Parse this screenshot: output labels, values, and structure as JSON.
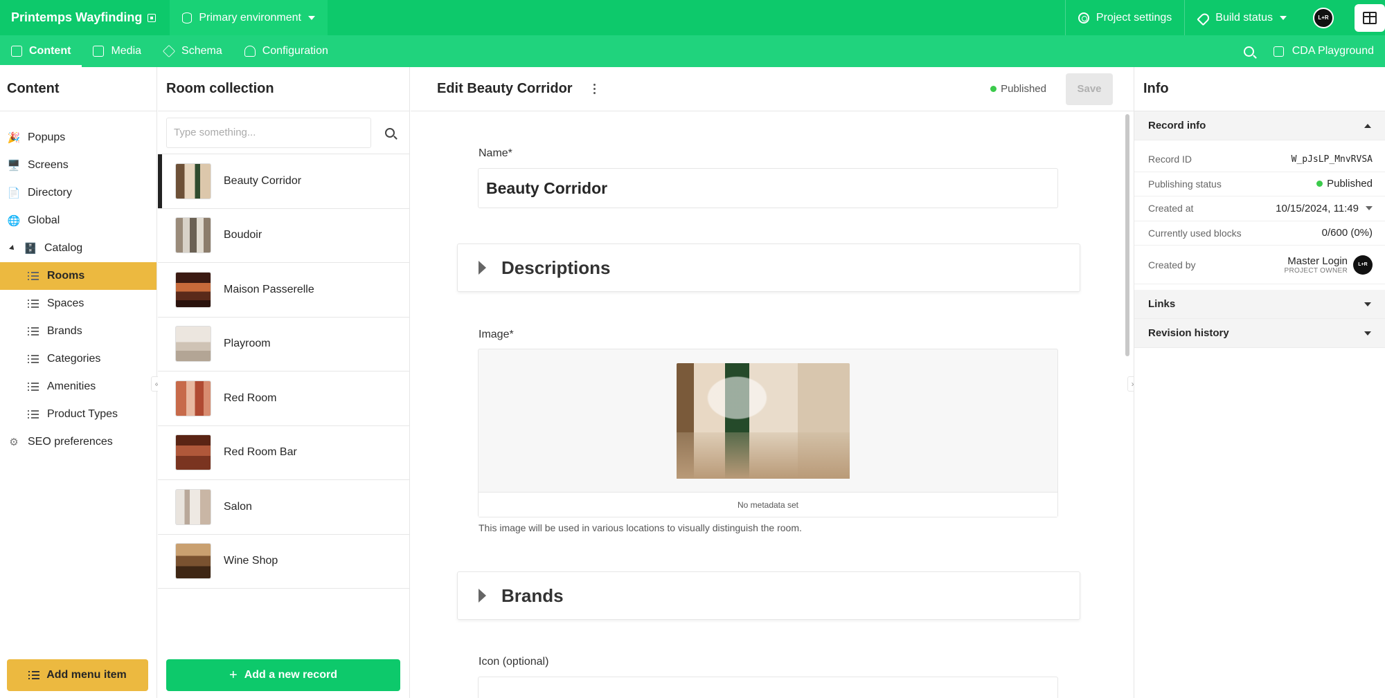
{
  "topbar": {
    "project_name": "Printemps Wayfinding",
    "environment": "Primary environment",
    "project_settings": "Project settings",
    "build_status": "Build status",
    "avatar_initials": "L+R"
  },
  "subnav": {
    "tabs": [
      {
        "label": "Content",
        "icon": "edit-icon",
        "active": true
      },
      {
        "label": "Media",
        "icon": "image-icon"
      },
      {
        "label": "Schema",
        "icon": "layers-icon"
      },
      {
        "label": "Configuration",
        "icon": "wrench-icon"
      }
    ],
    "cda_playground": "CDA Playground"
  },
  "sidebar": {
    "title": "Content",
    "items": [
      {
        "label": "Popups",
        "icon": "🎉"
      },
      {
        "label": "Screens",
        "icon": "🖥️"
      },
      {
        "label": "Directory",
        "icon": "📄"
      },
      {
        "label": "Global",
        "icon": "🌐"
      },
      {
        "label": "Catalog",
        "icon": "🗄️"
      },
      {
        "label": "Rooms"
      },
      {
        "label": "Spaces"
      },
      {
        "label": "Brands"
      },
      {
        "label": "Categories"
      },
      {
        "label": "Amenities"
      },
      {
        "label": "Product Types"
      },
      {
        "label": "SEO preferences"
      }
    ],
    "add_menu_item": "Add menu item"
  },
  "collection": {
    "title": "Room collection",
    "search_placeholder": "Type something...",
    "records": [
      {
        "name": "Beauty Corridor",
        "selected": true
      },
      {
        "name": "Boudoir"
      },
      {
        "name": "Maison Passerelle"
      },
      {
        "name": "Playroom"
      },
      {
        "name": "Red Room"
      },
      {
        "name": "Red Room Bar"
      },
      {
        "name": "Salon"
      },
      {
        "name": "Wine Shop"
      }
    ],
    "add_record": "Add a new record"
  },
  "editor": {
    "title": "Edit Beauty Corridor",
    "status": "Published",
    "save_label": "Save",
    "name_label": "Name*",
    "name_value": "Beauty Corridor",
    "descriptions_section": "Descriptions",
    "image_label": "Image*",
    "image_meta": "No metadata set",
    "image_hint": "This image will be used in various locations to visually distinguish the room.",
    "brands_section": "Brands",
    "icon_label": "Icon (optional)"
  },
  "info": {
    "title": "Info",
    "record_info": "Record info",
    "rows": {
      "record_id_label": "Record ID",
      "record_id_value": "W_pJsLP_MnvRVSA",
      "publishing_label": "Publishing status",
      "publishing_value": "Published",
      "created_at_label": "Created at",
      "created_at_value": "10/15/2024, 11:49",
      "blocks_label": "Currently used blocks",
      "blocks_value": "0/600 (0%)",
      "created_by_label": "Created by",
      "created_by_name": "Master Login",
      "created_by_role": "PROJECT OWNER"
    },
    "links": "Links",
    "revision_history": "Revision history"
  },
  "colors": {
    "brand_green": "#0dc96b",
    "accent_yellow": "#ecb940",
    "published_green": "#3bca4b"
  }
}
